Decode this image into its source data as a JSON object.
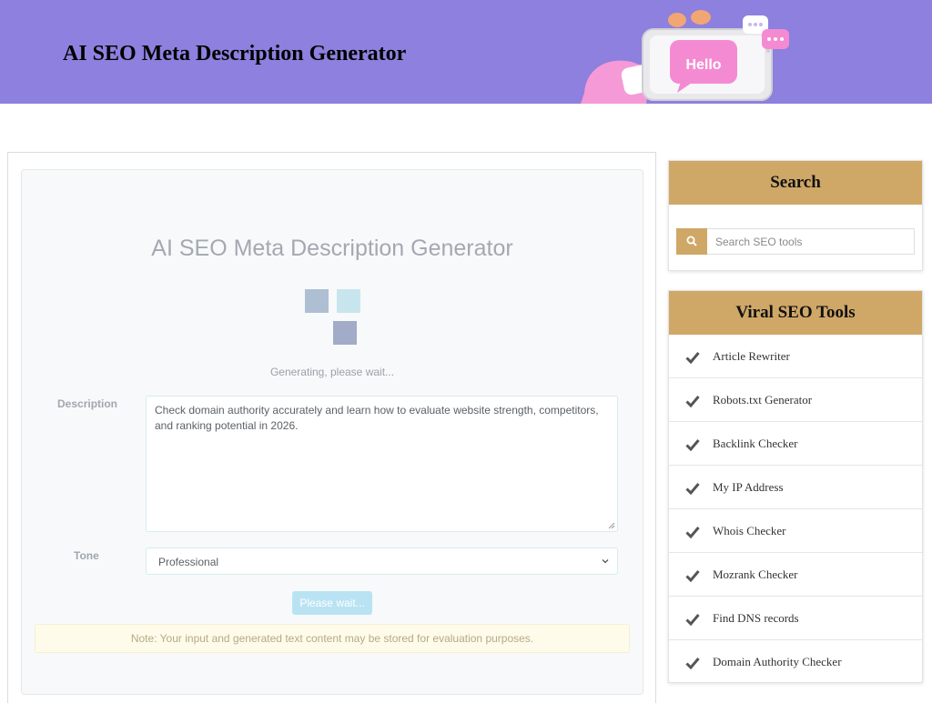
{
  "header": {
    "title": "AI SEO Meta Description Generator",
    "hero_text": "Hello",
    "accent_color": "#8d80de"
  },
  "tool": {
    "title": "AI SEO Meta Description Generator",
    "loading_text": "Generating, please wait...",
    "description_label": "Description",
    "description_value": "Check domain authority accurately and learn how to evaluate website strength, competitors, and ranking potential in 2026.",
    "tone_label": "Tone",
    "tone_value": "Professional",
    "button_label": "Please wait...",
    "note": "Note: Your input and generated text content may be stored for evaluation purposes."
  },
  "sidebar": {
    "search_title": "Search",
    "search_placeholder": "Search SEO tools",
    "tools_title": "Viral SEO Tools",
    "tools": [
      "Article Rewriter",
      "Robots.txt Generator",
      "Backlink Checker",
      "My IP Address",
      "Whois Checker",
      "Mozrank Checker",
      "Find DNS records",
      "Domain Authority Checker"
    ],
    "accent_color": "#cfa767"
  }
}
